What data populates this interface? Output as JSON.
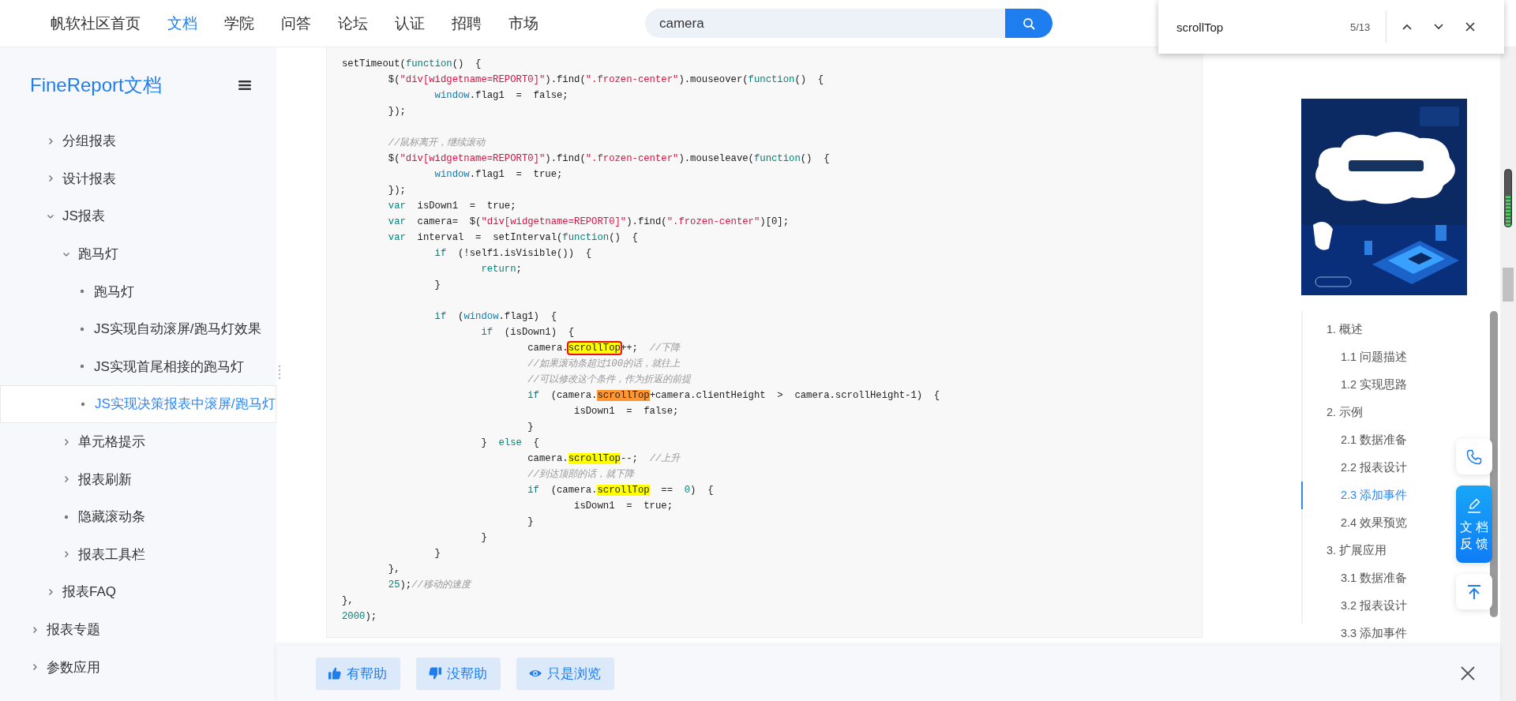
{
  "nav": {
    "links": [
      {
        "label": "帆软社区首页",
        "selected": false
      },
      {
        "label": "文档",
        "selected": true
      },
      {
        "label": "学院",
        "selected": false
      },
      {
        "label": "问答",
        "selected": false
      },
      {
        "label": "论坛",
        "selected": false
      },
      {
        "label": "认证",
        "selected": false
      },
      {
        "label": "招聘",
        "selected": false
      },
      {
        "label": "市场",
        "selected": false
      }
    ],
    "search": {
      "value": "camera"
    }
  },
  "find_bar": {
    "value": "scrollTop",
    "count": "5/13"
  },
  "sidebar": {
    "title": "FineReport文档",
    "tree": [
      {
        "children": [
          {
            "label": "分组报表",
            "kind": "folder",
            "expanded": false,
            "selected": false
          },
          {
            "label": "设计报表",
            "kind": "folder",
            "expanded": false,
            "selected": false
          },
          {
            "label": "JS报表",
            "kind": "folder",
            "expanded": true,
            "selected": false,
            "children": [
              {
                "label": "跑马灯",
                "kind": "folder",
                "expanded": true,
                "selected": false,
                "children": [
                  {
                    "label": "跑马灯",
                    "kind": "leaf",
                    "selected": false
                  },
                  {
                    "label": "JS实现自动滚屏/跑马灯效果",
                    "kind": "leaf",
                    "selected": false
                  },
                  {
                    "label": "JS实现首尾相接的跑马灯",
                    "kind": "leaf",
                    "selected": false
                  },
                  {
                    "label": "JS实现决策报表中滚屏/跑马灯",
                    "kind": "leaf",
                    "selected": true
                  }
                ]
              },
              {
                "label": "单元格提示",
                "kind": "folder",
                "expanded": false,
                "selected": false
              },
              {
                "label": "报表刷新",
                "kind": "folder",
                "expanded": false,
                "selected": false
              },
              {
                "label": "隐藏滚动条",
                "kind": "leaf",
                "selected": false
              },
              {
                "label": "报表工具栏",
                "kind": "folder",
                "expanded": false,
                "selected": false
              }
            ]
          },
          {
            "label": "报表FAQ",
            "kind": "folder",
            "expanded": false,
            "selected": false
          }
        ]
      },
      {
        "label": "报表专题",
        "kind": "folder",
        "expanded": false,
        "selected": false
      },
      {
        "label": "参数应用",
        "kind": "folder",
        "expanded": false,
        "selected": false
      }
    ]
  },
  "code": {
    "lines": [
      {
        "tokens": [
          {
            "text": "setTimeout(",
            "kind": "plain"
          },
          {
            "text": "function",
            "kind": "keyword"
          },
          {
            "text": "()  {",
            "kind": "plain"
          }
        ],
        "children": [
          {
            "tokens": [
              {
                "text": "$(",
                "kind": "plain"
              },
              {
                "text": "\"div[widgetname=REPORT0]\"",
                "kind": "string"
              },
              {
                "text": ").find(",
                "kind": "plain"
              },
              {
                "text": "\".frozen-center\"",
                "kind": "string"
              },
              {
                "text": ").mouseover(",
                "kind": "plain"
              },
              {
                "text": "function",
                "kind": "keyword"
              },
              {
                "text": "()  {",
                "kind": "plain"
              }
            ],
            "children": [
              {
                "tokens": [
                  {
                    "text": "window",
                    "kind": "object"
                  },
                  {
                    "text": ".flag1  =  false;",
                    "kind": "plain"
                  }
                ]
              }
            ]
          },
          {
            "tokens": [
              {
                "text": "});",
                "kind": "plain"
              }
            ]
          },
          {
            "blank_before": true,
            "tokens": [
              {
                "text": "//鼠标离开，继续滚动",
                "kind": "comment"
              }
            ]
          },
          {
            "tokens": [
              {
                "text": "$(",
                "kind": "plain"
              },
              {
                "text": "\"div[widgetname=REPORT0]\"",
                "kind": "string"
              },
              {
                "text": ").find(",
                "kind": "plain"
              },
              {
                "text": "\".frozen-center\"",
                "kind": "string"
              },
              {
                "text": ").mouseleave(",
                "kind": "plain"
              },
              {
                "text": "function",
                "kind": "keyword"
              },
              {
                "text": "()  {",
                "kind": "plain"
              }
            ],
            "children": [
              {
                "tokens": [
                  {
                    "text": "window",
                    "kind": "object"
                  },
                  {
                    "text": ".flag1  =  true;",
                    "kind": "plain"
                  }
                ]
              }
            ]
          },
          {
            "tokens": [
              {
                "text": "});",
                "kind": "plain"
              }
            ]
          },
          {
            "tokens": [
              {
                "text": "var",
                "kind": "keyword"
              },
              {
                "text": "  isDown1  =  true;",
                "kind": "plain"
              }
            ]
          },
          {
            "tokens": [
              {
                "text": "var",
                "kind": "keyword"
              },
              {
                "text": "  camera=  $(",
                "kind": "plain"
              },
              {
                "text": "\"div[widgetname=REPORT0]\"",
                "kind": "string"
              },
              {
                "text": ").find(",
                "kind": "plain"
              },
              {
                "text": "\".frozen-center\"",
                "kind": "string"
              },
              {
                "text": ")[0];",
                "kind": "plain"
              }
            ]
          },
          {
            "tokens": [
              {
                "text": "var",
                "kind": "keyword"
              },
              {
                "text": "  interval  =  setInterval(",
                "kind": "plain"
              },
              {
                "text": "function",
                "kind": "keyword"
              },
              {
                "text": "()  {",
                "kind": "plain"
              }
            ],
            "children": [
              {
                "tokens": [
                  {
                    "text": "if",
                    "kind": "keyword"
                  },
                  {
                    "text": "  (!self1.isVisible())  {",
                    "kind": "plain"
                  }
                ],
                "children": [
                  {
                    "tokens": [
                      {
                        "text": "return",
                        "kind": "keyword"
                      },
                      {
                        "text": ";",
                        "kind": "plain"
                      }
                    ]
                  }
                ]
              },
              {
                "tokens": [
                  {
                    "text": "}",
                    "kind": "plain"
                  }
                ]
              },
              {
                "blank_before": true,
                "tokens": [
                  {
                    "text": "if",
                    "kind": "keyword"
                  },
                  {
                    "text": "  (",
                    "kind": "plain"
                  },
                  {
                    "text": "window",
                    "kind": "object"
                  },
                  {
                    "text": ".flag1)  {",
                    "kind": "plain"
                  }
                ],
                "children": [
                  {
                    "tokens": [
                      {
                        "text": "if",
                        "kind": "keyword"
                      },
                      {
                        "text": "  (isDown1)  {",
                        "kind": "plain"
                      }
                    ],
                    "children": [
                      {
                        "tokens": [
                          {
                            "text": "camera.",
                            "kind": "plain"
                          },
                          {
                            "text": "scrollTop",
                            "kind": "match",
                            "boxed": true
                          },
                          {
                            "text": "++;  ",
                            "kind": "plain"
                          },
                          {
                            "text": "//下降",
                            "kind": "comment"
                          }
                        ]
                      },
                      {
                        "tokens": [
                          {
                            "text": "//如果滚动条超过100的话，就往上",
                            "kind": "comment"
                          }
                        ]
                      },
                      {
                        "tokens": [
                          {
                            "text": "//可以修改这个条件，作为折返的前提",
                            "kind": "comment"
                          }
                        ]
                      },
                      {
                        "tokens": [
                          {
                            "text": "if",
                            "kind": "keyword"
                          },
                          {
                            "text": "  (camera.",
                            "kind": "plain"
                          },
                          {
                            "text": "scrollTop",
                            "kind": "current"
                          },
                          {
                            "text": "+camera.clientHeight  >  camera.scrollHeight-1)  {",
                            "kind": "plain"
                          }
                        ],
                        "children": [
                          {
                            "tokens": [
                              {
                                "text": "isDown1  =  false;",
                                "kind": "plain"
                              }
                            ]
                          }
                        ]
                      },
                      {
                        "tokens": [
                          {
                            "text": "}",
                            "kind": "plain"
                          }
                        ]
                      }
                    ]
                  },
                  {
                    "tokens": [
                      {
                        "text": "}  ",
                        "kind": "plain"
                      },
                      {
                        "text": "else",
                        "kind": "keyword"
                      },
                      {
                        "text": "  {",
                        "kind": "plain"
                      }
                    ],
                    "children": [
                      {
                        "tokens": [
                          {
                            "text": "camera.",
                            "kind": "plain"
                          },
                          {
                            "text": "scrollTop",
                            "kind": "match"
                          },
                          {
                            "text": "--;  ",
                            "kind": "plain"
                          },
                          {
                            "text": "//上升",
                            "kind": "comment"
                          }
                        ]
                      },
                      {
                        "tokens": [
                          {
                            "text": "//到达顶部的话，就下降",
                            "kind": "comment"
                          }
                        ]
                      },
                      {
                        "tokens": [
                          {
                            "text": "if",
                            "kind": "keyword"
                          },
                          {
                            "text": "  (camera.",
                            "kind": "plain"
                          },
                          {
                            "text": "scrollTop",
                            "kind": "match"
                          },
                          {
                            "text": "  ==  ",
                            "kind": "plain"
                          },
                          {
                            "text": "0",
                            "kind": "number"
                          },
                          {
                            "text": ")  {",
                            "kind": "plain"
                          }
                        ],
                        "children": [
                          {
                            "tokens": [
                              {
                                "text": "isDown1  =  true;",
                                "kind": "plain"
                              }
                            ]
                          }
                        ]
                      },
                      {
                        "tokens": [
                          {
                            "text": "}",
                            "kind": "plain"
                          }
                        ]
                      }
                    ]
                  },
                  {
                    "tokens": [
                      {
                        "text": "}",
                        "kind": "plain"
                      }
                    ]
                  }
                ]
              },
              {
                "tokens": [
                  {
                    "text": "}",
                    "kind": "plain"
                  }
                ]
              }
            ]
          },
          {
            "tokens": [
              {
                "text": "},",
                "kind": "plain"
              }
            ]
          },
          {
            "tokens": [
              {
                "text": "25",
                "kind": "number"
              },
              {
                "text": ");",
                "kind": "plain"
              },
              {
                "text": "//移动的速度",
                "kind": "comment"
              }
            ]
          }
        ]
      },
      {
        "tokens": [
          {
            "text": "},",
            "kind": "plain"
          }
        ]
      },
      {
        "tokens": [
          {
            "text": "2000",
            "kind": "number"
          },
          {
            "text": ");",
            "kind": "plain"
          }
        ]
      }
    ]
  },
  "toc": {
    "items": [
      {
        "label": "1. 概述",
        "selected": false,
        "children": [
          {
            "label": "1.1 问题描述",
            "selected": false
          },
          {
            "label": "1.2 实现思路",
            "selected": false
          }
        ]
      },
      {
        "label": "2. 示例",
        "selected": false,
        "children": [
          {
            "label": "2.1 数据准备",
            "selected": false
          },
          {
            "label": "2.2 报表设计",
            "selected": false
          },
          {
            "label": "2.3 添加事件",
            "selected": true
          },
          {
            "label": "2.4 效果预览",
            "selected": false
          }
        ]
      },
      {
        "label": "3. 扩展应用",
        "selected": false,
        "children": [
          {
            "label": "3.1 数据准备",
            "selected": false
          },
          {
            "label": "3.2 报表设计",
            "selected": false
          },
          {
            "label": "3.3 添加事件",
            "selected": false
          }
        ]
      }
    ]
  },
  "float_buttons": [
    {
      "kind": "phone"
    },
    {
      "kind": "feedback",
      "label": "文档反馈"
    },
    {
      "kind": "top"
    }
  ],
  "feedback": {
    "buttons": [
      {
        "kind": "like",
        "label": "有帮助"
      },
      {
        "kind": "dislike",
        "label": "没帮助"
      },
      {
        "kind": "view",
        "label": "只是浏览"
      }
    ]
  }
}
